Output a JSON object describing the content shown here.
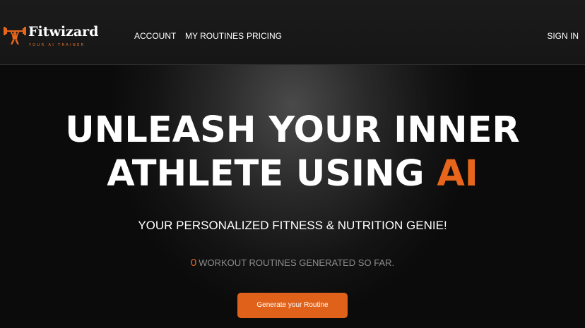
{
  "header": {
    "brand_name": "Fitwizard",
    "brand_tagline": "YOUR AI TRAINER",
    "logo_icon": "weightlifter-icon",
    "nav": [
      {
        "label": "ACCOUNT"
      },
      {
        "label": "MY ROUTINES"
      },
      {
        "label": "PRICING"
      }
    ],
    "sign_in_label": "SIGN IN"
  },
  "hero": {
    "line1": "UNLEASH YOUR INNER",
    "line2_prefix": "ATHLETE USING ",
    "line2_accent": "AI",
    "subtitle": "YOUR PERSONALIZED FITNESS & NUTRITION GENIE!",
    "counter_value": "0",
    "counter_text": "WORKOUT ROUTINES GENERATED SO FAR.",
    "cta_label": "Generate your Routine"
  },
  "colors": {
    "accent": "#e8661c",
    "background": "#0a0a0a",
    "text": "#ffffff",
    "muted": "#8c8c8c"
  }
}
